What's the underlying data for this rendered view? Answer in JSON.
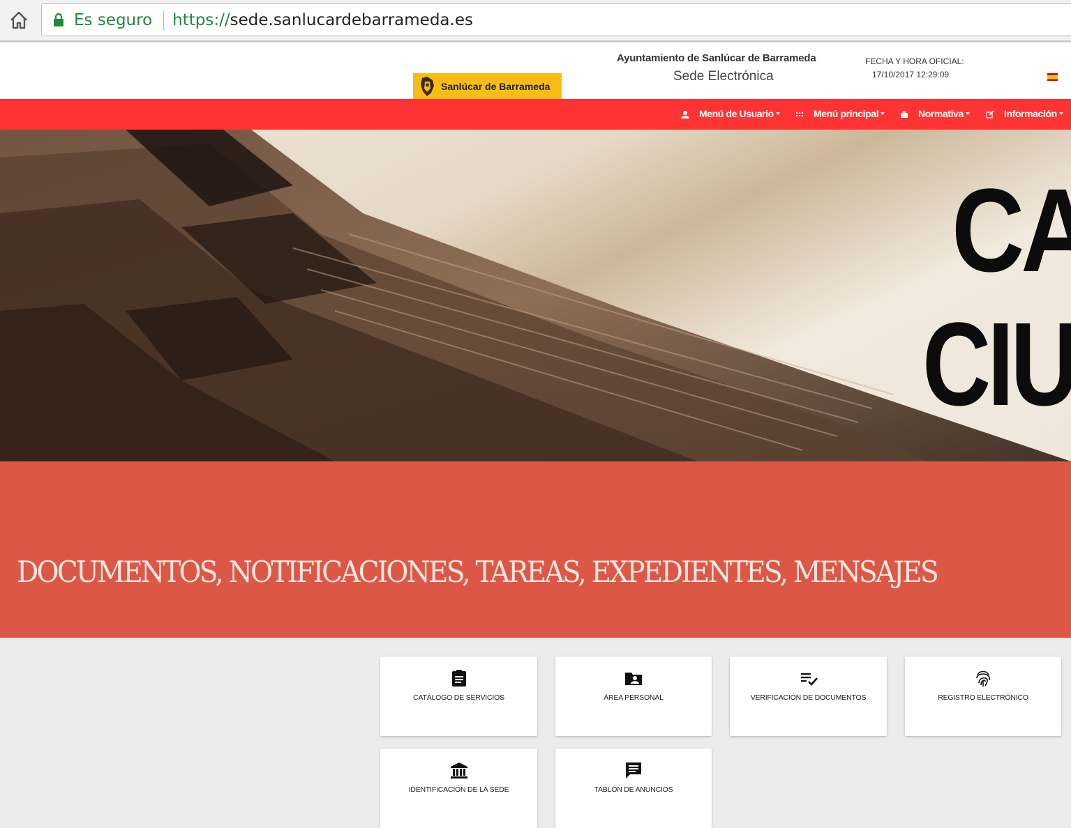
{
  "browser": {
    "secure_label": "Es seguro",
    "url_protocol": "https://",
    "url_rest": "sede.sanlucardebarrameda.es"
  },
  "header": {
    "logo_text": "Sanlúcar de Barrameda",
    "org_name": "Ayuntamiento de Sanlúcar de Barrameda",
    "sede_name": "Sede Electrónica",
    "fecha_label": "FECHA Y HORA OFICIAL:",
    "fecha_value": "17/10/2017  12:29:09",
    "language_flag": "spain-flag"
  },
  "nav": {
    "items": [
      {
        "label": "Menú de Usuario",
        "icon": "user-icon"
      },
      {
        "label": "Menú principal",
        "icon": "grid-icon"
      },
      {
        "label": "Normativa",
        "icon": "briefcase-icon"
      },
      {
        "label": "Información",
        "icon": "edit-icon"
      }
    ]
  },
  "hero": {
    "line1": "CA",
    "line2": "CIU"
  },
  "banner": {
    "text": "DOCUMENTOS, NOTIFICACIONES, TAREAS, EXPEDIENTES, MENSAJES"
  },
  "cards": [
    {
      "label": "CATÁLOGO DE SERVICIOS",
      "icon": "clipboard-icon"
    },
    {
      "label": "ÁREA PERSONAL",
      "icon": "folder-user-icon"
    },
    {
      "label": "VERIFICACIÓN DE DOCUMENTOS",
      "icon": "list-check-icon"
    },
    {
      "label": "REGISTRO ELECTRÓNICO",
      "icon": "fingerprint-icon"
    },
    {
      "label": "IDENTIFICACIÓN DE LA SEDE",
      "icon": "bank-icon"
    },
    {
      "label": "TABLÓN DE ANUNCIOS",
      "icon": "message-icon"
    }
  ],
  "colors": {
    "nav_red": "#ff3333",
    "banner_red": "#dd5747",
    "logo_yellow": "#f7bd16",
    "secure_green": "#1f8a3b"
  }
}
